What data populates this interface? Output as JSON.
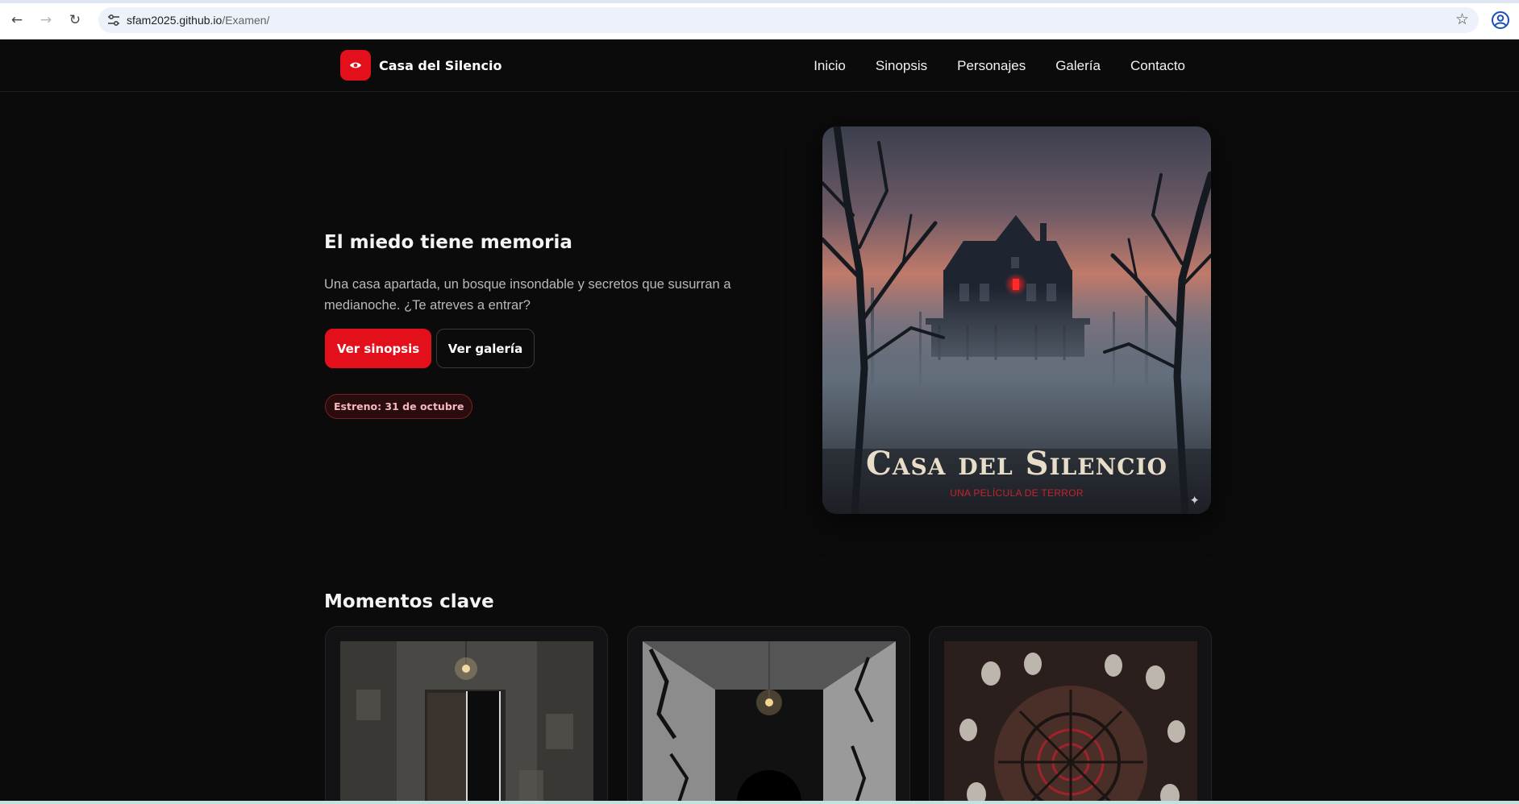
{
  "browser": {
    "url_host": "sfam2025.github.io",
    "url_path": "/Examen/"
  },
  "site": {
    "brand": "Casa del Silencio",
    "nav": [
      {
        "label": "Inicio"
      },
      {
        "label": "Sinopsis"
      },
      {
        "label": "Personajes"
      },
      {
        "label": "Galería"
      },
      {
        "label": "Contacto"
      }
    ]
  },
  "hero": {
    "title": "El miedo tiene memoria",
    "description": "Una casa apartada, un bosque insondable y secretos que susurran a medianoche. ¿Te atreves a entrar?",
    "primary_button": "Ver sinopsis",
    "secondary_button": "Ver galería",
    "release_badge": "Estreno: 31 de octubre",
    "poster": {
      "title": "Casa del Silencio",
      "subtitle": "UNA PELÍCULA DE TERROR",
      "corner_glyph": "✦"
    }
  },
  "moments": {
    "title": "Momentos clave",
    "cards": [
      {
        "scene": "hallway-door-icon"
      },
      {
        "scene": "dark-corridor-icon"
      },
      {
        "scene": "skull-wheel-icon"
      }
    ]
  },
  "colors": {
    "accent": "#e3101c",
    "background": "#0b0b0c"
  }
}
